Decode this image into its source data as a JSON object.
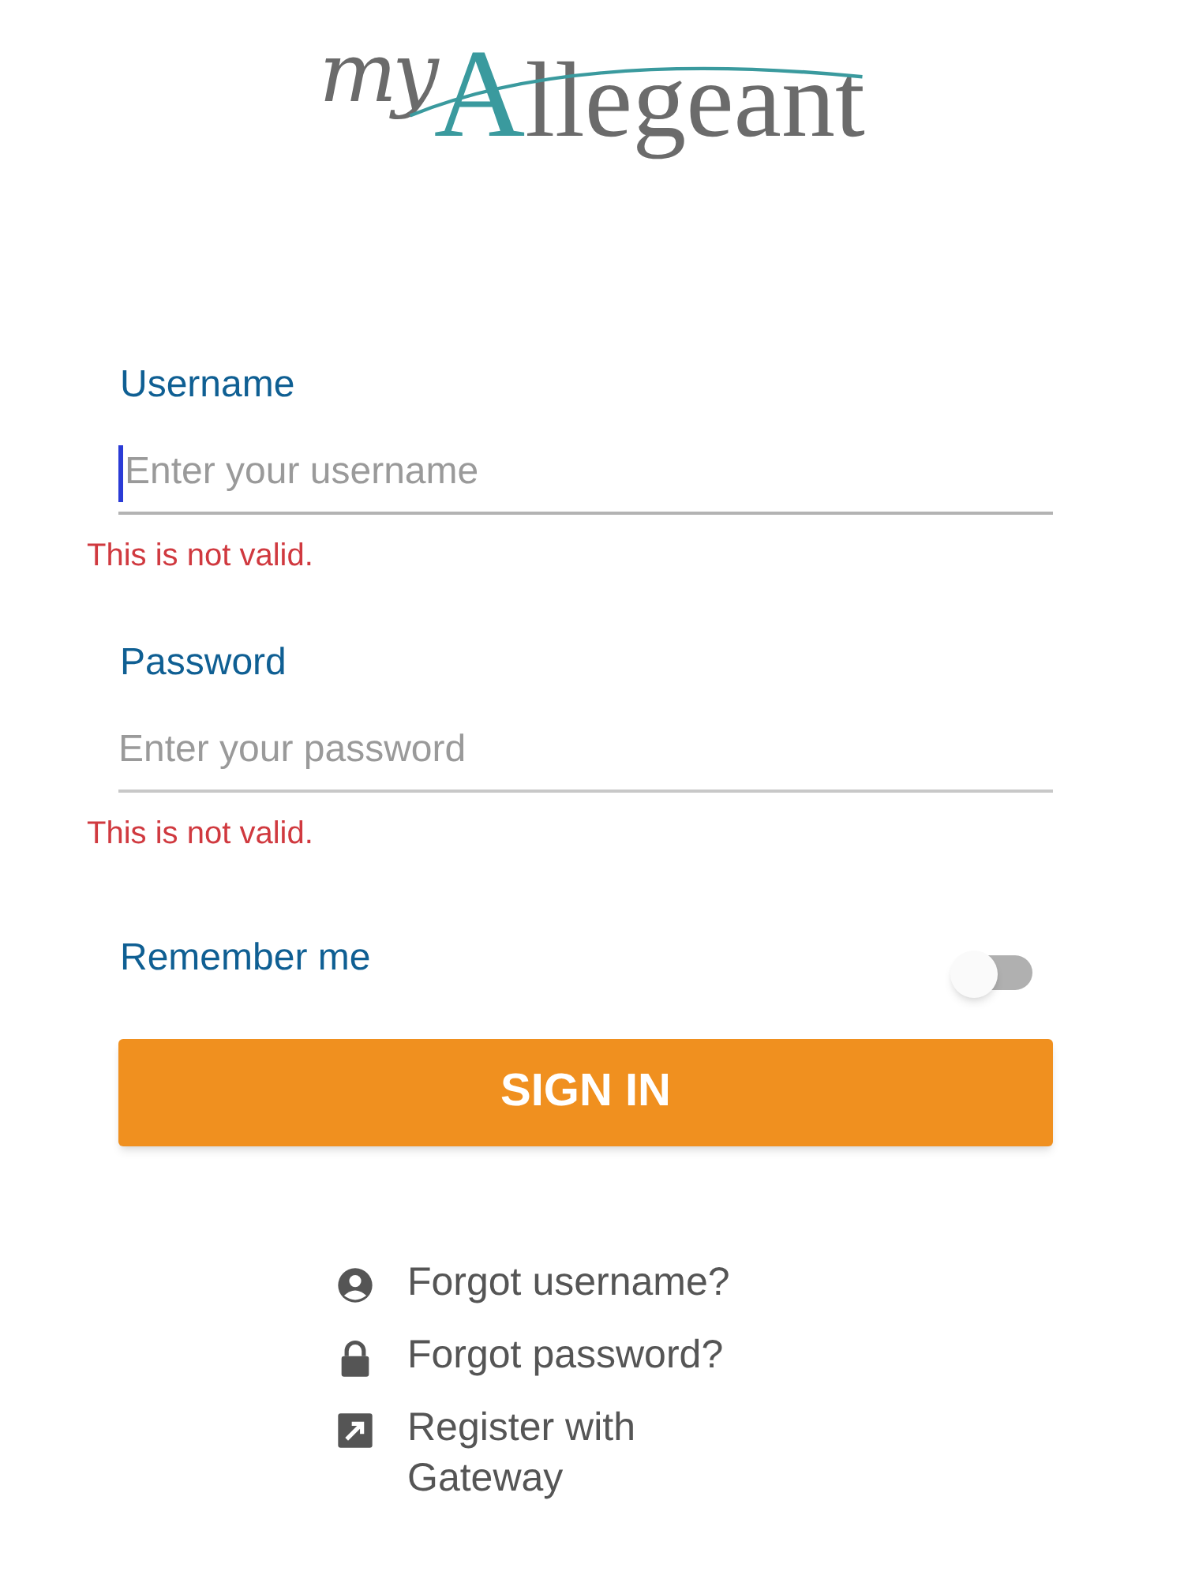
{
  "logo": {
    "prefix": "my",
    "name": "Allegeant"
  },
  "fields": [
    {
      "label": "Username",
      "placeholder": "Enter your username",
      "error": "This is not valid.",
      "focused": true
    },
    {
      "label": "Password",
      "placeholder": "Enter your password",
      "error": "This is not valid.",
      "focused": false
    }
  ],
  "remember": {
    "label": "Remember me",
    "on": false
  },
  "sign_in": "SIGN IN",
  "links": [
    {
      "kind": "user",
      "label": "Forgot username?"
    },
    {
      "kind": "lock",
      "label": "Forgot password?"
    },
    {
      "kind": "external",
      "label": "Register with Gateway"
    }
  ]
}
